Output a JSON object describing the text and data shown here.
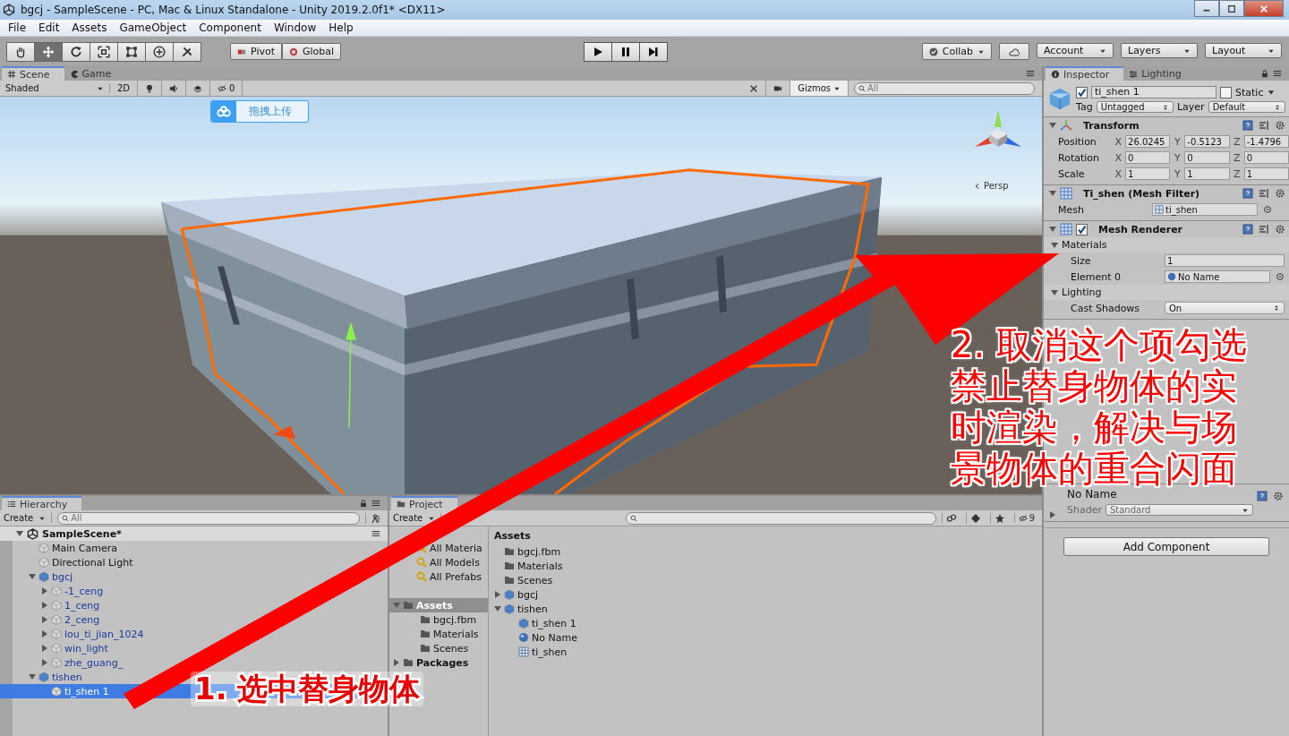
{
  "window": {
    "title": "bgcj - SampleScene - PC, Mac & Linux Standalone - Unity 2019.2.0f1* <DX11>"
  },
  "menu": [
    "File",
    "Edit",
    "Assets",
    "GameObject",
    "Component",
    "Window",
    "Help"
  ],
  "toolbar": {
    "tools": [
      {
        "kind": "hand",
        "selected": false
      },
      {
        "kind": "move",
        "selected": true
      },
      {
        "kind": "rotate",
        "selected": false
      },
      {
        "kind": "scale",
        "selected": false
      },
      {
        "kind": "rect",
        "selected": false
      },
      {
        "kind": "transform",
        "selected": false
      },
      {
        "kind": "custom",
        "selected": false
      }
    ],
    "pivot": "Pivot",
    "space": "Global",
    "collab": "Collab",
    "account": "Account",
    "layers": "Layers",
    "layout": "Layout"
  },
  "scene_panel": {
    "tabs": [
      {
        "label": "Scene",
        "kind": "scene",
        "selected": true
      },
      {
        "label": "Game",
        "kind": "game",
        "selected": false
      }
    ],
    "shading": "Shaded",
    "mode_2d": "2D",
    "hidden_count": "0",
    "gizmos": "Gizmos",
    "search_placeholder": "All",
    "upload_button": "拖拽上传",
    "projection": "Persp"
  },
  "hierarchy": {
    "title": "Hierarchy",
    "create": "Create",
    "search_placeholder": "All",
    "scene": "SampleScene*",
    "items": [
      {
        "label": "Main Camera",
        "kind": "object",
        "selected": false
      },
      {
        "label": "Directional Light",
        "kind": "object",
        "selected": false
      },
      {
        "label": "bgcj",
        "kind": "prefab",
        "selected": false,
        "expanded": true,
        "children": [
          {
            "label": "-1_ceng",
            "kind": "prefab_part",
            "selected": false,
            "expanded": false
          },
          {
            "label": "1_ceng",
            "kind": "prefab_part",
            "selected": false,
            "expanded": false
          },
          {
            "label": "2_ceng",
            "kind": "prefab_part",
            "selected": false,
            "expanded": false
          },
          {
            "label": "lou_ti_jian_1024",
            "kind": "prefab_part",
            "selected": false,
            "expanded": false
          },
          {
            "label": "win_light",
            "kind": "prefab_part",
            "selected": false,
            "expanded": false
          },
          {
            "label": "zhe_guang_",
            "kind": "prefab_part",
            "selected": false,
            "expanded": false
          }
        ]
      },
      {
        "label": "tishen",
        "kind": "prefab",
        "selected": false,
        "expanded": true,
        "children": [
          {
            "label": "ti_shen 1",
            "kind": "prefab_part",
            "selected": true
          }
        ]
      }
    ]
  },
  "project": {
    "title": "Project",
    "create": "Create",
    "hidden_count": "9",
    "favorites": [
      "All Materia",
      "All Models",
      "All Prefabs"
    ],
    "folders": [
      {
        "label": "Assets",
        "selected": true,
        "expanded": true,
        "children": [
          {
            "label": "bgcj.fbm"
          },
          {
            "label": "Materials"
          },
          {
            "label": "Scenes"
          }
        ]
      },
      {
        "label": "Packages",
        "selected": false,
        "expanded": false
      }
    ],
    "list_title": "Assets",
    "assets": [
      {
        "label": "bgcj.fbm",
        "kind": "folder"
      },
      {
        "label": "Materials",
        "kind": "folder"
      },
      {
        "label": "Scenes",
        "kind": "folder"
      },
      {
        "label": "bgcj",
        "kind": "prefab",
        "expanded": false
      },
      {
        "label": "tishen",
        "kind": "prefab",
        "expanded": true,
        "children": [
          {
            "label": "ti_shen 1",
            "kind": "prefab"
          },
          {
            "label": "No Name",
            "kind": "material"
          },
          {
            "label": "ti_shen",
            "kind": "mesh"
          }
        ]
      }
    ]
  },
  "inspector": {
    "tabs": [
      {
        "label": "Inspector",
        "selected": true
      },
      {
        "label": "Lighting",
        "selected": false
      }
    ],
    "object": {
      "active": true,
      "name": "ti_shen 1",
      "static_label": "Static",
      "static": false,
      "tag_label": "Tag",
      "tag": "Untagged",
      "layer_label": "Layer",
      "layer": "Default"
    },
    "components": [
      {
        "kind": "transform",
        "title": "Transform",
        "expanded": true,
        "rows": [
          {
            "label": "Position",
            "fields": [
              {
                "axis": "X",
                "value": "26.0245"
              },
              {
                "axis": "Y",
                "value": "-0.5123"
              },
              {
                "axis": "Z",
                "value": "-1.4796"
              }
            ]
          },
          {
            "label": "Rotation",
            "fields": [
              {
                "axis": "X",
                "value": "0"
              },
              {
                "axis": "Y",
                "value": "0"
              },
              {
                "axis": "Z",
                "value": "0"
              }
            ]
          },
          {
            "label": "Scale",
            "fields": [
              {
                "axis": "X",
                "value": "1"
              },
              {
                "axis": "Y",
                "value": "1"
              },
              {
                "axis": "Z",
                "value": "1"
              }
            ]
          }
        ]
      },
      {
        "kind": "mesh_filter",
        "title": "Ti_shen (Mesh Filter)",
        "expanded": true,
        "groups": [
          {
            "fields": [
              {
                "label": "Mesh",
                "value": "ti_shen",
                "kind": "object"
              }
            ]
          }
        ]
      },
      {
        "kind": "mesh_renderer",
        "title": "Mesh Renderer",
        "expanded": true,
        "enabled": true,
        "groups": [
          {
            "label": "Materials",
            "expanded": true,
            "fields": [
              {
                "label": "Size",
                "value": "1",
                "kind": "text"
              },
              {
                "label": "Element 0",
                "value": "No Name",
                "kind": "object"
              }
            ]
          },
          {
            "label": "Lighting",
            "expanded": true,
            "fields": [
              {
                "label": "Cast Shadows",
                "value": "On",
                "kind": "dropdown"
              }
            ]
          }
        ]
      },
      {
        "kind": "material",
        "title": "No Name",
        "expanded": false,
        "shader_label": "Shader",
        "shader": "Standard"
      }
    ],
    "add_component": "Add Component"
  },
  "annotations": [
    {
      "kind": "arrow"
    },
    {
      "kind": "text",
      "text": "1. 选中替身物体"
    },
    {
      "kind": "text",
      "text": "2. 取消这个项勾选禁止替身物体的实时渲染，解决与场景物体的重合闪面"
    }
  ]
}
